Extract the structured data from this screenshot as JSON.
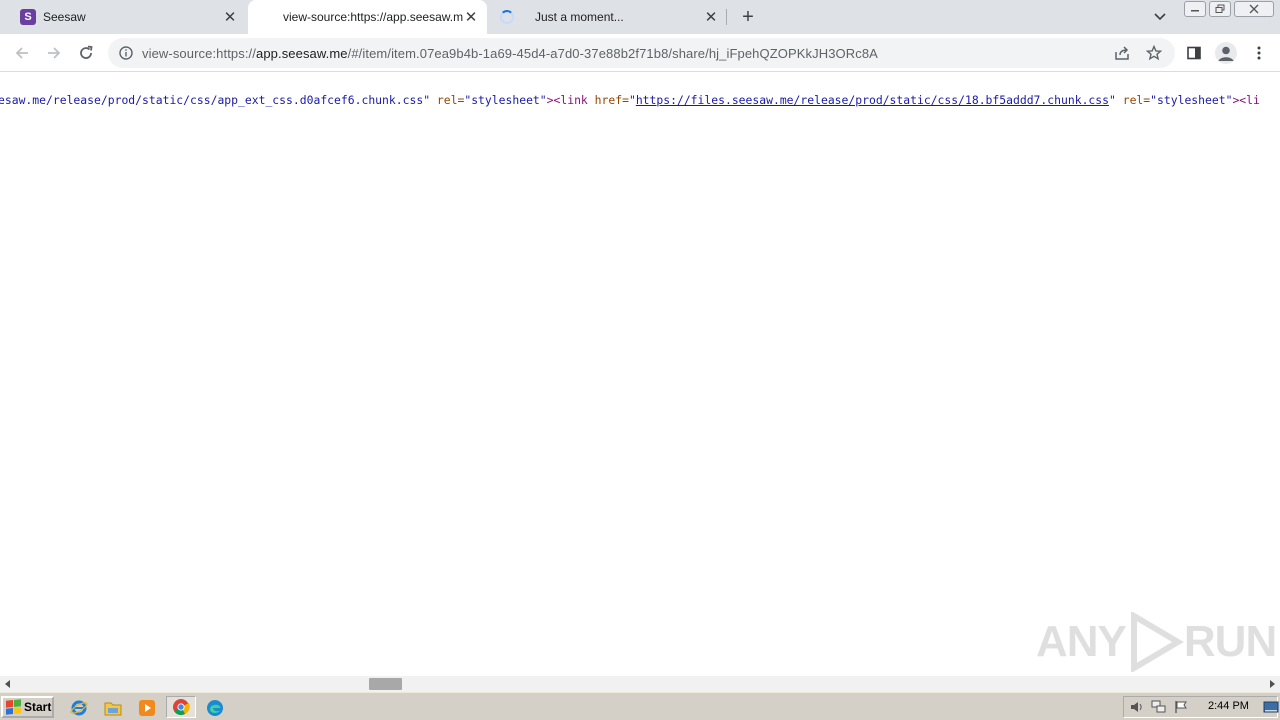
{
  "tabs": [
    {
      "title": "Seesaw",
      "favicon": "seesaw-logo-icon",
      "active": false
    },
    {
      "title": "view-source:https://app.seesaw.me",
      "favicon": "none",
      "active": true
    },
    {
      "title": "Just a moment...",
      "favicon": "loading-spinner-icon",
      "active": false
    }
  ],
  "address_bar": {
    "prefix": "view-source:https://",
    "host": "app.seesaw.me",
    "path": "/#/item/item.07ea9b4b-1a69-45d4-a7d0-37e88b2f71b8/share/hj_iFpehQZOPKkJH3ORc8A"
  },
  "source_line": {
    "seg1_val": "esaw.me/release/prod/static/css/app_ext_css.d0afcef6.chunk.css",
    "seg1_quote": "\"",
    "seg2_attr": " rel=",
    "seg2_val": "\"stylesheet\"",
    "seg3_tag": "><link ",
    "seg3_attr": "href=",
    "seg3_quote_open": "\"",
    "seg3_link": "https://files.seesaw.me/release/prod/static/css/18.bf5addd7.chunk.css",
    "seg3_quote_close": "\"",
    "seg4_attr": " rel=",
    "seg4_val": "\"stylesheet\"",
    "seg5_tag": "><li"
  },
  "watermark": {
    "text_left": "ANY",
    "text_right": "RUN"
  },
  "taskbar": {
    "start_label": "Start",
    "clock": "2:44 PM"
  },
  "colors": {
    "accent": "#1a73e8",
    "seesaw_brand": "#6b3fa0",
    "source_value": "#1a1aa6",
    "source_tag": "#881280",
    "source_attr": "#994500"
  }
}
